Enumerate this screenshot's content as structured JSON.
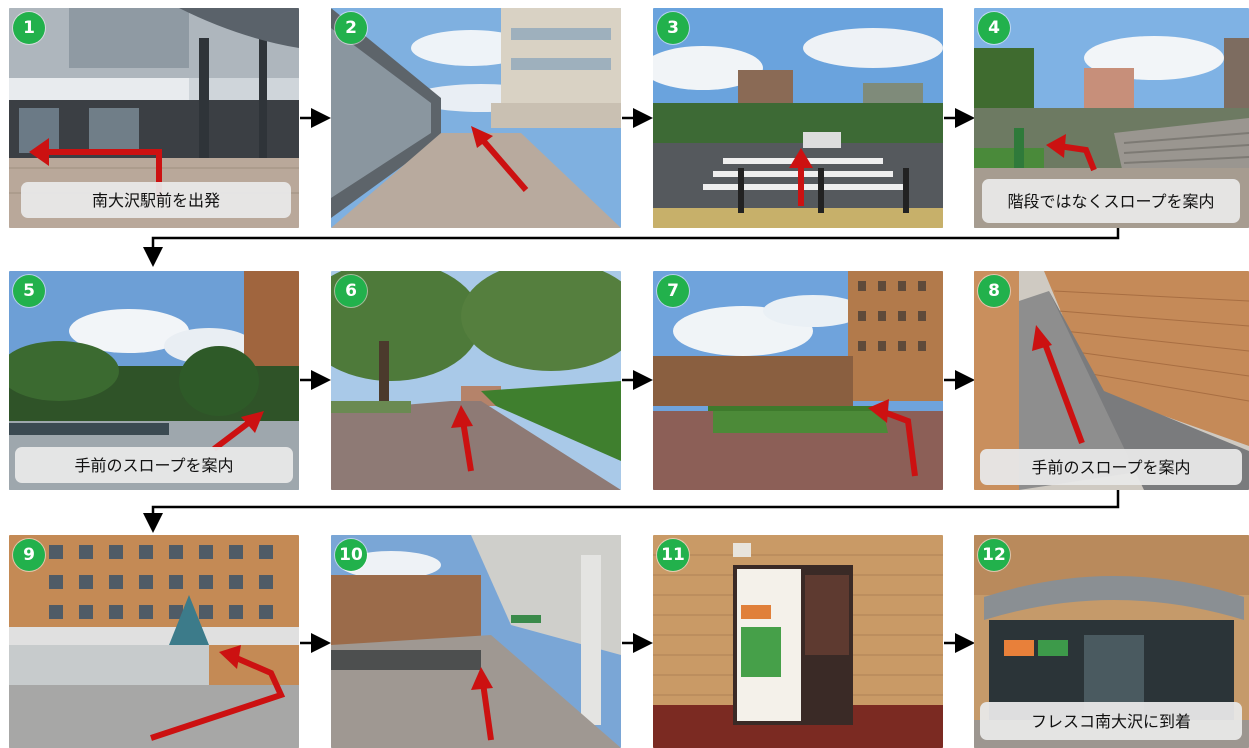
{
  "steps": [
    {
      "number": "1",
      "caption": "南大沢駅前を出発"
    },
    {
      "number": "2",
      "caption": ""
    },
    {
      "number": "3",
      "caption": ""
    },
    {
      "number": "4",
      "caption": "階段ではなくスロープを案内"
    },
    {
      "number": "5",
      "caption": "手前のスロープを案内"
    },
    {
      "number": "6",
      "caption": ""
    },
    {
      "number": "7",
      "caption": ""
    },
    {
      "number": "8",
      "caption": "手前のスロープを案内"
    },
    {
      "number": "9",
      "caption": ""
    },
    {
      "number": "10",
      "caption": ""
    },
    {
      "number": "11",
      "caption": ""
    },
    {
      "number": "12",
      "caption": "フレスコ南大沢に到着"
    }
  ],
  "colors": {
    "badge": "#22b14c",
    "guide_arrow": "#cc1111",
    "connector": "#000000",
    "caption_bg": "#e8e8e8"
  }
}
